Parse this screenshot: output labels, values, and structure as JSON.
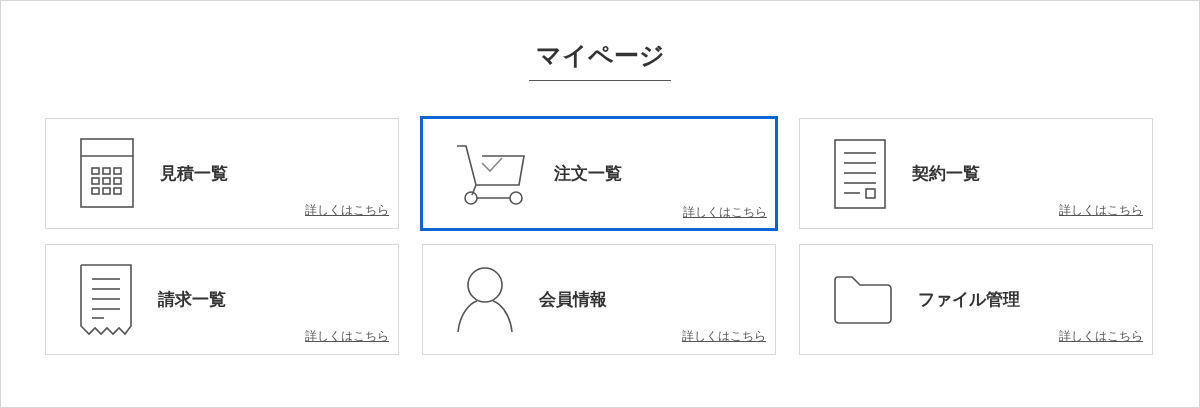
{
  "title": "マイページ",
  "cards": [
    {
      "kind": "calculator",
      "label": "見積一覧",
      "link": "詳しくはこちら",
      "selected": false
    },
    {
      "kind": "cart",
      "label": "注文一覧",
      "link": "詳しくはこちら",
      "selected": true
    },
    {
      "kind": "document",
      "label": "契約一覧",
      "link": "詳しくはこちら",
      "selected": false
    },
    {
      "kind": "receipt",
      "label": "請求一覧",
      "link": "詳しくはこちら",
      "selected": false
    },
    {
      "kind": "person",
      "label": "会員情報",
      "link": "詳しくはこちら",
      "selected": false
    },
    {
      "kind": "folder",
      "label": "ファイル管理",
      "link": "詳しくはこちら",
      "selected": false
    }
  ]
}
